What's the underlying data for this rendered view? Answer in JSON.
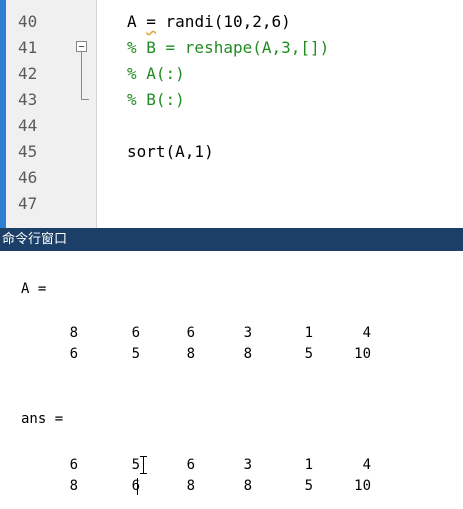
{
  "editor": {
    "line_numbers": [
      "40",
      "41",
      "42",
      "43",
      "44",
      "45",
      "46",
      "47"
    ],
    "lines": [
      {
        "pre": "A ",
        "warn": "=",
        "post": " randi(10,2,6)"
      },
      {
        "text": "% B = reshape(A,3,[])"
      },
      {
        "text": "% A(:)"
      },
      {
        "text": "% B(:)"
      },
      {
        "text": ""
      },
      {
        "text": "sort(A,1)"
      },
      {
        "text": ""
      },
      {
        "text": ""
      }
    ]
  },
  "command_window": {
    "title": "命令行窗口",
    "outputs": [
      {
        "label": "A =",
        "rows": [
          [
            "8",
            "6",
            "6",
            "3",
            "1",
            "4"
          ],
          [
            "6",
            "5",
            "8",
            "8",
            "5",
            "10"
          ]
        ]
      },
      {
        "label": "ans =",
        "rows": [
          [
            "6",
            "5",
            "6",
            "3",
            "1",
            "4"
          ],
          [
            "8",
            "6",
            "8",
            "8",
            "5",
            "10"
          ]
        ]
      }
    ]
  }
}
